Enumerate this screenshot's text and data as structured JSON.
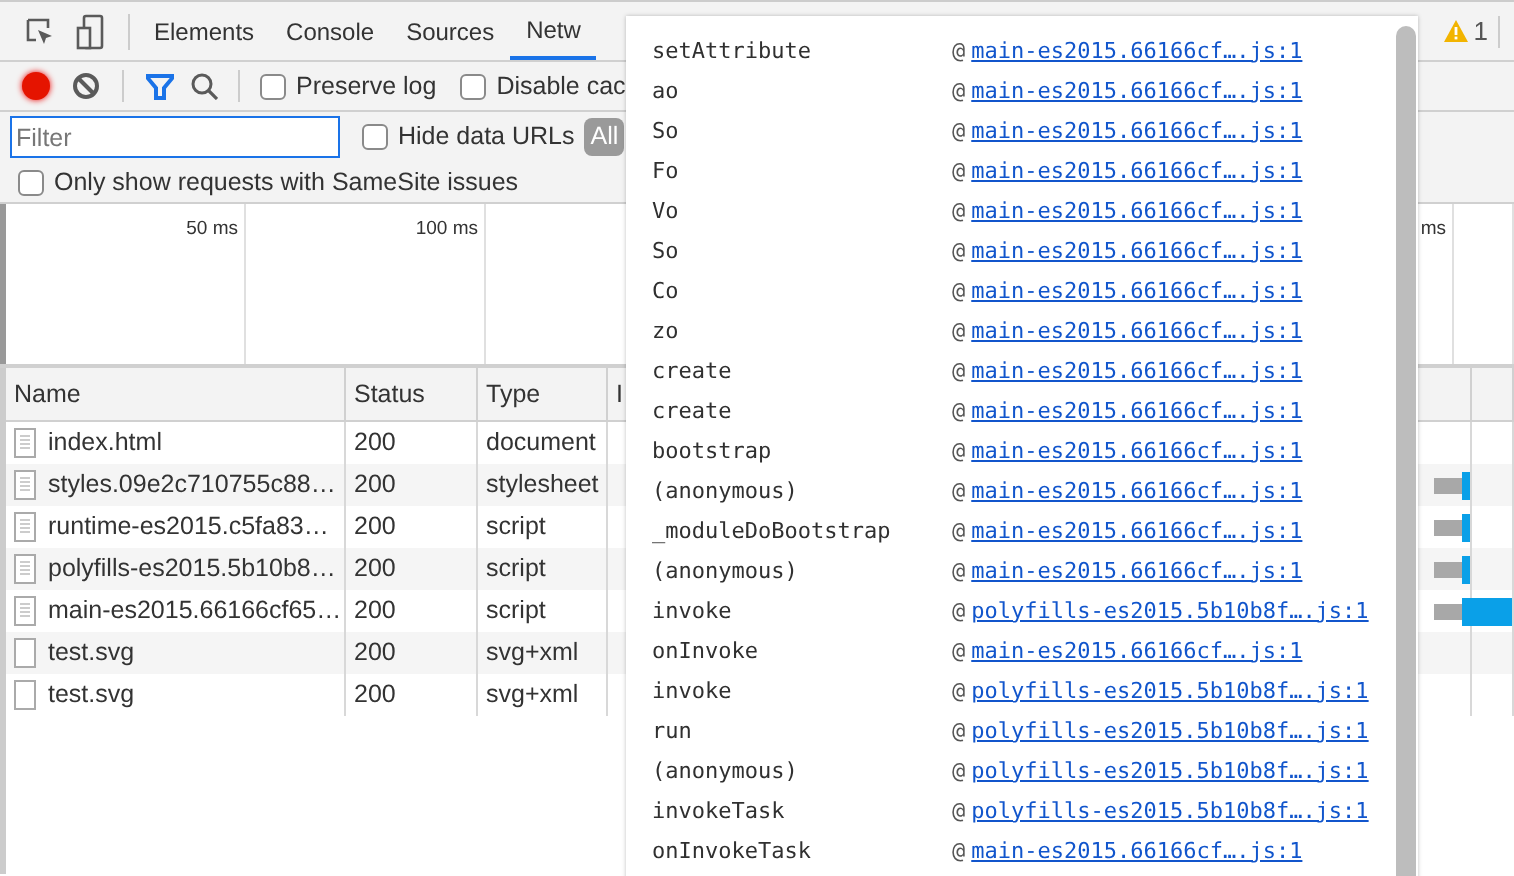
{
  "tabs": [
    {
      "label": "Elements",
      "selected": false
    },
    {
      "label": "Console",
      "selected": false
    },
    {
      "label": "Sources",
      "selected": false
    },
    {
      "label": "Netw",
      "selected": true
    }
  ],
  "warning_count": "1",
  "toolbar": {
    "recording": true,
    "checkboxes": [
      {
        "label": "Preserve log",
        "checked": false
      },
      {
        "label": "Disable cac",
        "checked": false
      }
    ]
  },
  "filter": {
    "placeholder": "Filter",
    "hide_data_urls": {
      "label": "Hide data URLs",
      "checked": false
    },
    "type_button": {
      "label": "All",
      "selected": true
    }
  },
  "samesite": {
    "label": "Only show requests with SameSite issues",
    "checked": false
  },
  "timeline": {
    "ticks": [
      "50 ms",
      "100 ms",
      "ms"
    ]
  },
  "table": {
    "columns": [
      "Name",
      "Status",
      "Type",
      "I"
    ],
    "rows": [
      {
        "name": "index.html",
        "status": "200",
        "type": "document",
        "kind": "document"
      },
      {
        "name": "styles.09e2c710755c88…",
        "status": "200",
        "type": "stylesheet",
        "kind": "document",
        "waterfall": {
          "long": false
        }
      },
      {
        "name": "runtime-es2015.c5fa83…",
        "status": "200",
        "type": "script",
        "kind": "document",
        "waterfall": {
          "long": false
        }
      },
      {
        "name": "polyfills-es2015.5b10b8…",
        "status": "200",
        "type": "script",
        "kind": "document",
        "waterfall": {
          "long": false
        }
      },
      {
        "name": "main-es2015.66166cf65…",
        "status": "200",
        "type": "script",
        "kind": "document",
        "waterfall": {
          "long": true
        }
      },
      {
        "name": "test.svg",
        "status": "200",
        "type": "svg+xml",
        "kind": "blank"
      },
      {
        "name": "test.svg",
        "status": "200",
        "type": "svg+xml",
        "kind": "blank"
      }
    ]
  },
  "call_stack": [
    {
      "function": "setAttribute",
      "source": "main-es2015.66166cf….js:1"
    },
    {
      "function": "ao",
      "source": "main-es2015.66166cf….js:1"
    },
    {
      "function": "So",
      "source": "main-es2015.66166cf….js:1"
    },
    {
      "function": "Fo",
      "source": "main-es2015.66166cf….js:1"
    },
    {
      "function": "Vo",
      "source": "main-es2015.66166cf….js:1"
    },
    {
      "function": "So",
      "source": "main-es2015.66166cf….js:1"
    },
    {
      "function": "Co",
      "source": "main-es2015.66166cf….js:1"
    },
    {
      "function": "zo",
      "source": "main-es2015.66166cf….js:1"
    },
    {
      "function": "create",
      "source": "main-es2015.66166cf….js:1"
    },
    {
      "function": "create",
      "source": "main-es2015.66166cf….js:1"
    },
    {
      "function": "bootstrap",
      "source": "main-es2015.66166cf….js:1"
    },
    {
      "function": "(anonymous)",
      "source": "main-es2015.66166cf….js:1"
    },
    {
      "function": "_moduleDoBootstrap",
      "source": "main-es2015.66166cf….js:1"
    },
    {
      "function": "(anonymous)",
      "source": "main-es2015.66166cf….js:1"
    },
    {
      "function": "invoke",
      "source": "polyfills-es2015.5b10b8f….js:1"
    },
    {
      "function": "onInvoke",
      "source": "main-es2015.66166cf….js:1"
    },
    {
      "function": "invoke",
      "source": "polyfills-es2015.5b10b8f….js:1"
    },
    {
      "function": "run",
      "source": "polyfills-es2015.5b10b8f….js:1"
    },
    {
      "function": "(anonymous)",
      "source": "polyfills-es2015.5b10b8f….js:1"
    },
    {
      "function": "invokeTask",
      "source": "polyfills-es2015.5b10b8f….js:1"
    },
    {
      "function": "onInvokeTask",
      "source": "main-es2015.66166cf….js:1"
    }
  ],
  "at_signs": "@"
}
